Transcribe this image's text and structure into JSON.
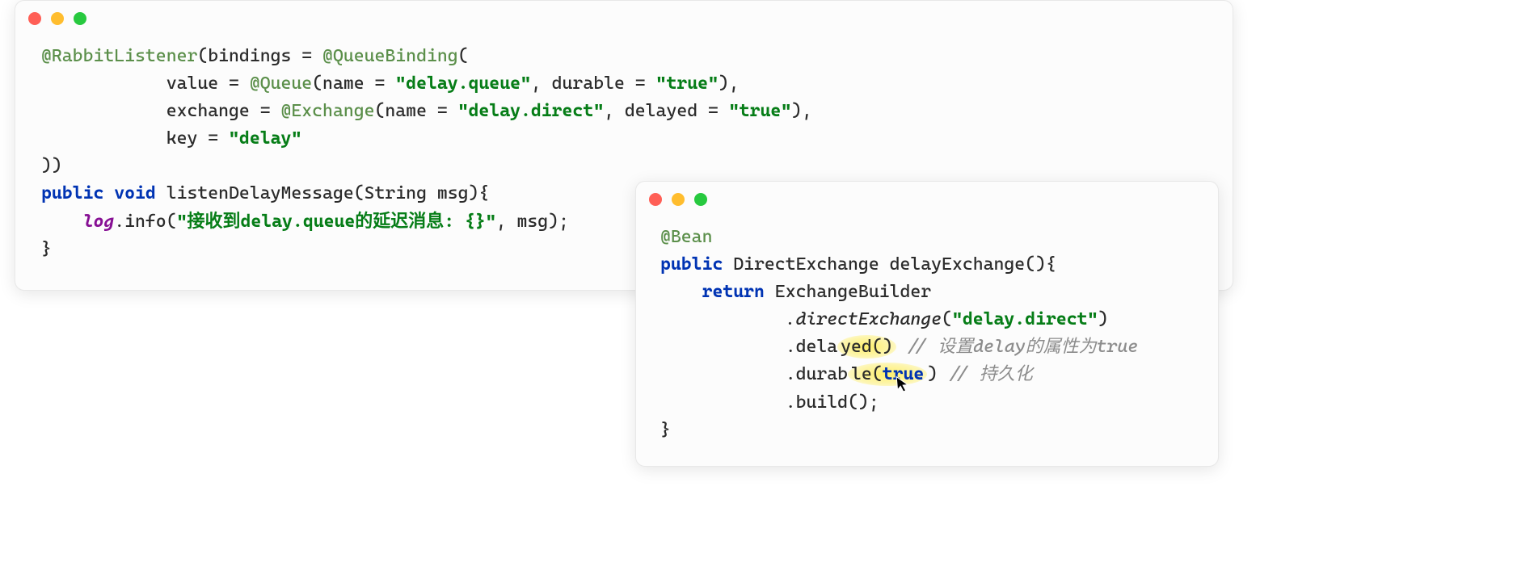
{
  "window1": {
    "l1": {
      "ann1": "@RabbitListener",
      "txt1": "(bindings = ",
      "ann2": "@QueueBinding",
      "txt2": "("
    },
    "l2": {
      "pad": "            ",
      "txt1": "value = ",
      "ann": "@Queue",
      "txt2": "(name = ",
      "str1": "\"delay.queue\"",
      "txt3": ", durable = ",
      "str2": "\"true\"",
      "txt4": "),"
    },
    "l3": {
      "pad": "            ",
      "txt1": "exchange = ",
      "ann": "@Exchange",
      "txt2": "(name = ",
      "str1": "\"delay.direct\"",
      "txt3": ", delayed = ",
      "str2": "\"true\"",
      "txt4": "),"
    },
    "l4": {
      "pad": "            ",
      "txt1": "key = ",
      "str1": "\"delay\""
    },
    "l5": {
      "txt": "))"
    },
    "l6": {
      "kw": "public void",
      "txt": " listenDelayMessage(String msg){"
    },
    "l7": {
      "pad": "    ",
      "log": "log",
      "txt1": ".info(",
      "str": "\"接收到delay.queue的延迟消息: {}\"",
      "txt2": ", msg);"
    },
    "l8": {
      "txt": "}"
    }
  },
  "window2": {
    "l1": {
      "ann": "@Bean"
    },
    "l2": {
      "kw": "public",
      "txt": " DirectExchange delayExchange(){"
    },
    "l3": {
      "pad": "    ",
      "kw": "return",
      "txt": " ExchangeBuilder"
    },
    "l4": {
      "pad": "            ",
      "ital": ".directExchange",
      "txt1": "(",
      "str": "\"delay.direct\"",
      "txt2": ")"
    },
    "l5": {
      "pad": "            ",
      "txt1": ".dela",
      "hl": "yed()",
      "sp": " ",
      "comm": "// 设置delay的属性为true"
    },
    "l6": {
      "pad": "            ",
      "txt1": ".durab",
      "hl": "le(",
      "kw": "true",
      "txt2": ") ",
      "comm": "// 持久化"
    },
    "l7": {
      "pad": "            ",
      "txt": ".build();"
    },
    "l8": {
      "txt": "}"
    }
  }
}
